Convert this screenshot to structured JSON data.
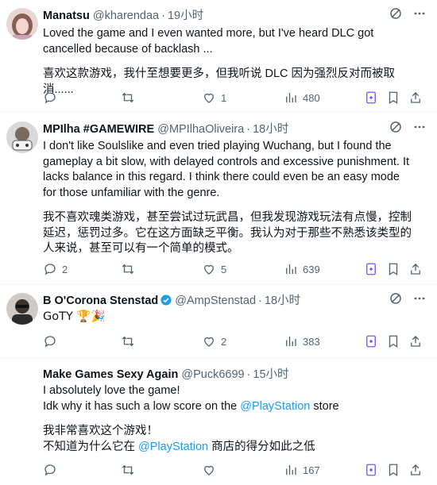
{
  "tweets": [
    {
      "author": "Manatsu",
      "handle": "@kharendaa",
      "dot": "·",
      "time": "19小时",
      "text_en": "Loved the game and I even wanted more, but I've heard DLC got cancelled because of backlash ...",
      "text_cn": "喜欢这款游戏，我什至想要更多，但我听说 DLC 因为强烈反对而被取消......",
      "replies": "",
      "retweets": "",
      "likes": "1",
      "views": "480"
    },
    {
      "author": "MPIlha #GAMEWIRE",
      "handle": "@MPIlhaOliveira",
      "dot": "·",
      "time": "18小时",
      "text_en": "I don't like Soulslike and even tried playing Wuchang, but I found the gameplay a bit slow, with delayed controls and excessive punishment. It lacks balance in this regard. I think there could even be an easy mode for those unfamiliar with the genre.",
      "text_cn": "我不喜欢魂类游戏，甚至尝试过玩武昌，但我发现游戏玩法有点慢，控制延迟，惩罚过多。它在这方面缺乏平衡。我认为对于那些不熟悉该类型的人来说，甚至可以有一个简单的模式。",
      "replies": "2",
      "retweets": "",
      "likes": "5",
      "views": "639"
    },
    {
      "author": "B O'Corona Stenstad",
      "handle": "@AmpStenstad",
      "dot": "·",
      "time": "18小时",
      "text_en": "GoTY 🏆🎉",
      "replies": "",
      "retweets": "",
      "likes": "2",
      "views": "383"
    },
    {
      "author": "Make Games Sexy Again",
      "handle": "@Puck6699",
      "dot": "·",
      "time": "15小时",
      "line1": "I absolutely love the game!",
      "line2_a": "Idk why it has such a low score on the ",
      "line2_link": "@PlayStation",
      "line2_b": " store",
      "line3": "我非常喜欢这个游戏！",
      "line4_a": "不知道为什么它在 ",
      "line4_link": "@PlayStation",
      "line4_b": " 商店的得分如此之低",
      "replies": "",
      "retweets": "",
      "likes": "",
      "views": "167"
    }
  ],
  "colors": {
    "text": "#0f1419",
    "muted": "#536471",
    "link": "#1d9bf0",
    "verified": "#1d9bf0",
    "grok": "#7856ff"
  },
  "icons": [
    "grok-icon",
    "more-icon",
    "reply-icon",
    "retweet-icon",
    "like-icon",
    "views-icon",
    "grok-explain-icon",
    "bookmark-icon",
    "share-icon",
    "verified-badge-icon"
  ]
}
